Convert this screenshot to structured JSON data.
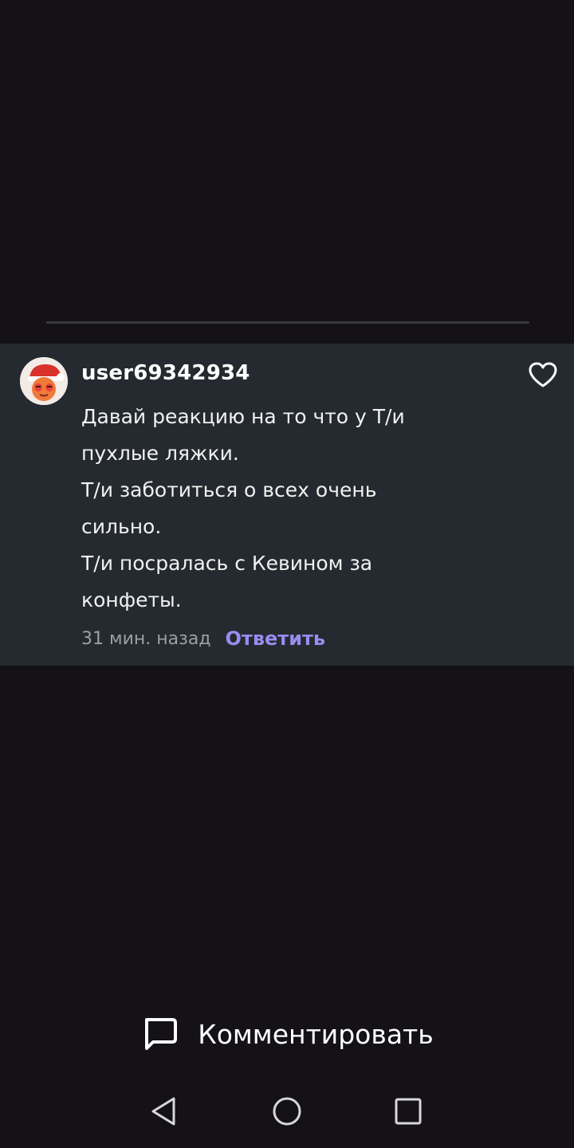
{
  "comment": {
    "username": "user69342934",
    "lines": [
      "Давай реакцию на то что у Т/и",
      "пухлые ляжки.",
      "Т/и заботиться о всех очень",
      "сильно.",
      "Т/и посралась с Кевином за",
      "конфеты."
    ],
    "timestamp": "31 мин. назад",
    "reply_label": "Ответить",
    "like_icon": "heart-outline-icon"
  },
  "comment_bar": {
    "label": "Комментировать",
    "icon": "chat-bubble-icon"
  },
  "nav": {
    "back_icon": "triangle-back-icon",
    "home_icon": "circle-home-icon",
    "recents_icon": "square-recents-icon"
  },
  "colors": {
    "background": "#141216",
    "card": "#242a2f",
    "accent": "#9a8cf0",
    "muted": "#9d9fa5"
  }
}
